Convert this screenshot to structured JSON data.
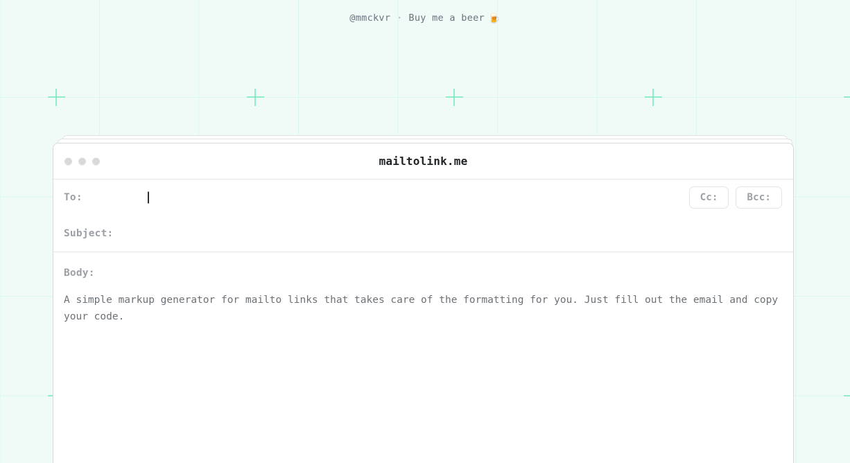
{
  "header": {
    "handle": "@mmckvr",
    "separator": "·",
    "beer_label": "Buy me a beer",
    "beer_icon": "🍺",
    "beer_icon_name": "beer-mug-emoji"
  },
  "window": {
    "title": "mailtolink.me",
    "traffic_lights": [
      "close-dot",
      "minimize-dot",
      "maximize-dot"
    ]
  },
  "form": {
    "to": {
      "label": "To:",
      "value": "",
      "placeholder": ""
    },
    "subject": {
      "label": "Subject:",
      "value": "",
      "placeholder": ""
    },
    "cc_button": "Cc:",
    "bcc_button": "Bcc:",
    "body": {
      "label": "Body:",
      "value": "A simple markup generator for mailto links that takes care of the formatting for you. Just fill out the email and copy your code.",
      "placeholder": ""
    }
  },
  "colors": {
    "page_background": "#f0fbf7",
    "grid_line": "#6ee7b7",
    "card_background": "#ffffff",
    "card_border": "#d9d9d9",
    "label_text": "#9aa0a6",
    "body_text": "#6b7176",
    "title_text": "#1f2326",
    "header_text": "#6b7280"
  }
}
